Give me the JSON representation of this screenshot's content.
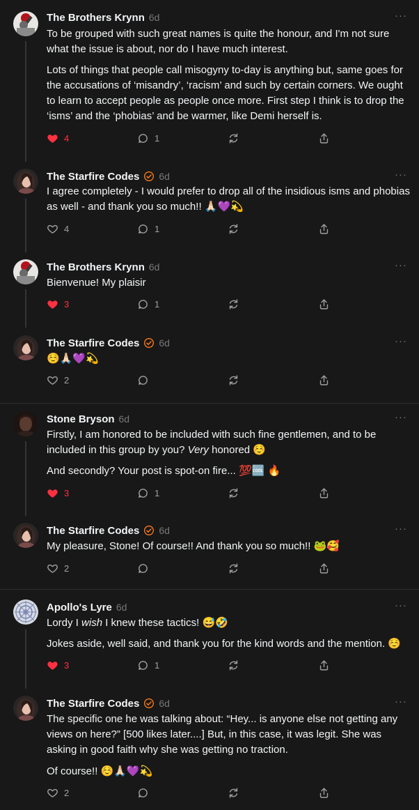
{
  "posts": [
    {
      "author": "The Brothers Krynn",
      "time": "6d",
      "verified": false,
      "avatar": "krynn",
      "paragraphs": [
        "To be grouped with such great names is quite the honour, and I'm not sure what the issue is about, nor do I have much interest.",
        "Lots of things that people call misogyny to-day is anything but, same goes for the accusations of ‘misandry’, ‘racism’ and such by certain corners. We ought to learn to accept people as people once more. First step I think is to drop the ‘isms’ and the ‘phobias’ and be warmer, like Demi herself is."
      ],
      "likes": "4",
      "liked": true,
      "replies": "1"
    },
    {
      "author": "The Starfire Codes",
      "time": "6d",
      "verified": true,
      "avatar": "starfire",
      "paragraphs": [
        "I agree completely - I would prefer to drop all of the insidious isms and phobias as well - and thank you so much!! 🙏🏻💜💫"
      ],
      "likes": "4",
      "liked": false,
      "replies": "1"
    },
    {
      "author": "The Brothers Krynn",
      "time": "6d",
      "verified": false,
      "avatar": "krynn",
      "paragraphs": [
        "Bienvenue! My plaisir"
      ],
      "likes": "3",
      "liked": true,
      "replies": "1"
    },
    {
      "author": "The Starfire Codes",
      "time": "6d",
      "verified": true,
      "avatar": "starfire",
      "paragraphs": [
        "☺️🙏🏻💜💫"
      ],
      "likes": "2",
      "liked": false,
      "replies": ""
    },
    {
      "author": "Stone Bryson",
      "time": "6d",
      "verified": false,
      "avatar": "stone",
      "paragraphs": [
        [
          "Firstly, I am honored to be included with such fine gentlemen, and to be included in this group by you? ",
          {
            "em": "Very"
          },
          " honored ☺️"
        ],
        "And secondly? Your post is spot-on fire... 💯🆒 🔥"
      ],
      "likes": "3",
      "liked": true,
      "replies": "1"
    },
    {
      "author": "The Starfire Codes",
      "time": "6d",
      "verified": true,
      "avatar": "starfire",
      "paragraphs": [
        "My pleasure, Stone! Of course!! And thank you so much!! 🐸🥰"
      ],
      "likes": "2",
      "liked": false,
      "replies": ""
    },
    {
      "author": "Apollo's Lyre",
      "time": "6d",
      "verified": false,
      "avatar": "apollo",
      "paragraphs": [
        [
          "Lordy I ",
          {
            "em": "wish"
          },
          " I knew these tactics! 😅🤣"
        ],
        "Jokes aside, well said, and thank you for the kind words and the mention. ☺️"
      ],
      "likes": "3",
      "liked": true,
      "replies": "1"
    },
    {
      "author": "The Starfire Codes",
      "time": "6d",
      "verified": true,
      "avatar": "starfire",
      "paragraphs": [
        "The specific one he was talking about: “Hey... is anyone else not getting any views on here?” [500 likes later....] But, in this case, it was legit. She was asking in good faith why she was getting no traction.",
        "Of course!! ☺️🙏🏻💜💫"
      ],
      "likes": "2",
      "liked": false,
      "replies": ""
    }
  ],
  "more_label": "···",
  "colors": {
    "liked": "#ff3040",
    "verified": "#ff7a1a",
    "icon": "#a0a0a0",
    "background": "#181818"
  }
}
